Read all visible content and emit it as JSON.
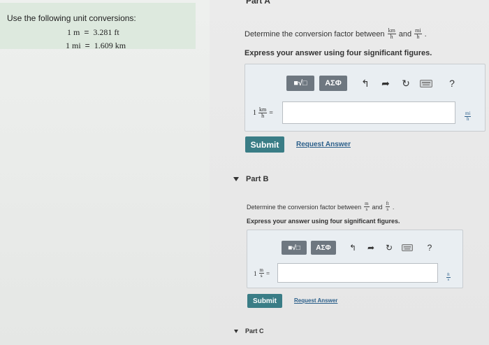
{
  "conversions": {
    "title": "Use the following unit conversions:",
    "rows": [
      {
        "left": "1 m",
        "eq": "=",
        "right": "3.281 ft"
      },
      {
        "left": "1 mi",
        "eq": "=",
        "right": "1.609 km"
      }
    ]
  },
  "part_a": {
    "title": "Part A",
    "prompt_prefix": "Determine the conversion factor between",
    "frac1": {
      "num": "km",
      "den": "h"
    },
    "and": "and",
    "frac2": {
      "num": "mi",
      "den": "h"
    },
    "period": ".",
    "instruction": "Express your answer using four significant figures.",
    "toolbar": {
      "templates_label": "■√□",
      "symbols_label": "ΑΣΦ",
      "help_label": "?"
    },
    "lhs_coef": "1",
    "lhs_frac": {
      "num": "km",
      "den": "h"
    },
    "lhs_eq": "=",
    "unit_frac": {
      "num": "mi",
      "den": "h"
    },
    "input_value": "",
    "submit_label": "Submit",
    "request_label": "Request Answer"
  },
  "part_b": {
    "title": "Part B",
    "prompt_prefix": "Determine the conversion factor between",
    "frac1": {
      "num": "m",
      "den": "s"
    },
    "and": "and",
    "frac2": {
      "num": "ft",
      "den": "s"
    },
    "period": ".",
    "instruction": "Express your answer using four significant figures.",
    "toolbar": {
      "templates_label": "■√□",
      "symbols_label": "ΑΣΦ",
      "help_label": "?"
    },
    "lhs_coef": "1",
    "lhs_frac": {
      "num": "m",
      "den": "s"
    },
    "lhs_eq": "=",
    "unit_frac": {
      "num": "ft",
      "den": "s"
    },
    "input_value": "",
    "submit_label": "Submit",
    "request_label": "Request Answer"
  },
  "part_c": {
    "title": "Part C"
  }
}
